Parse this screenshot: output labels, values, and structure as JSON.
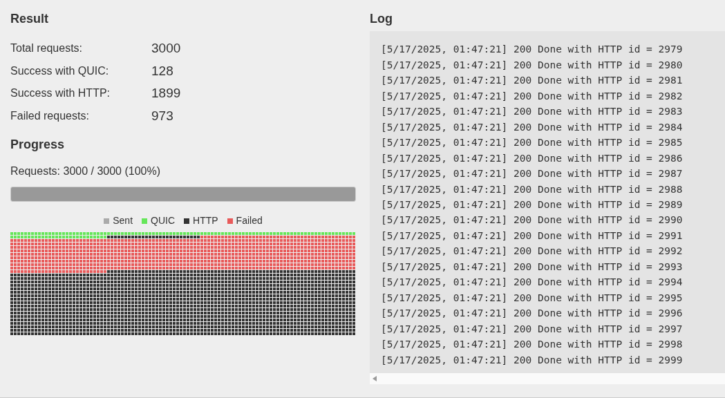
{
  "result": {
    "title": "Result",
    "rows": [
      {
        "kind": "total",
        "label": "Total requests:",
        "value": "3000"
      },
      {
        "kind": "quic",
        "label": "Success with QUIC:",
        "value": "128"
      },
      {
        "kind": "http",
        "label": "Success with HTTP:",
        "value": "1899"
      },
      {
        "kind": "failed",
        "label": "Failed requests:",
        "value": "973"
      }
    ]
  },
  "progress": {
    "title": "Progress",
    "label": "Requests: 3000 / 3000 (100%)",
    "level": 1.0
  },
  "legend": [
    {
      "label": "Sent",
      "color": "#aaaaaa"
    },
    {
      "label": "QUIC",
      "color": "#66e65a"
    },
    {
      "label": "HTTP",
      "color": "#333333"
    },
    {
      "label": "Failed",
      "color": "#e85a5a"
    }
  ],
  "log": {
    "title": "Log",
    "lines": [
      "[5/17/2025, 01:47:21] 200 Done with HTTP id = 2979",
      "[5/17/2025, 01:47:21] 200 Done with HTTP id = 2980",
      "[5/17/2025, 01:47:21] 200 Done with HTTP id = 2981",
      "[5/17/2025, 01:47:21] 200 Done with HTTP id = 2982",
      "[5/17/2025, 01:47:21] 200 Done with HTTP id = 2983",
      "[5/17/2025, 01:47:21] 200 Done with HTTP id = 2984",
      "[5/17/2025, 01:47:21] 200 Done with HTTP id = 2985",
      "[5/17/2025, 01:47:21] 200 Done with HTTP id = 2986",
      "[5/17/2025, 01:47:21] 200 Done with HTTP id = 2987",
      "[5/17/2025, 01:47:21] 200 Done with HTTP id = 2988",
      "[5/17/2025, 01:47:21] 200 Done with HTTP id = 2989",
      "[5/17/2025, 01:47:21] 200 Done with HTTP id = 2990",
      "[5/17/2025, 01:47:21] 200 Done with HTTP id = 2991",
      "[5/17/2025, 01:47:21] 200 Done with HTTP id = 2992",
      "[5/17/2025, 01:47:21] 200 Done with HTTP id = 2993",
      "[5/17/2025, 01:47:21] 200 Done with HTTP id = 2994",
      "[5/17/2025, 01:47:21] 200 Done with HTTP id = 2995",
      "[5/17/2025, 01:47:21] 200 Done with HTTP id = 2996",
      "[5/17/2025, 01:47:21] 200 Done with HTTP id = 2997",
      "[5/17/2025, 01:47:21] 200 Done with HTTP id = 2998",
      "[5/17/2025, 01:47:21] 200 Done with HTTP id = 2999"
    ]
  }
}
